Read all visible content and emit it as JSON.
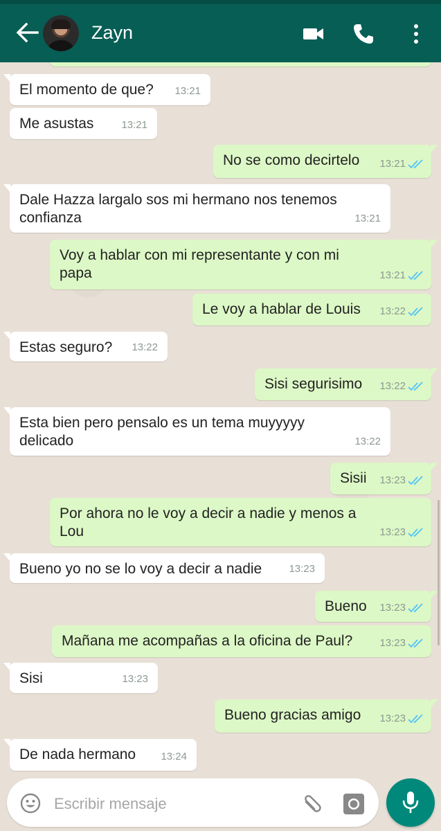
{
  "header": {
    "contact_name": "Zayn",
    "icons": [
      "back-arrow-icon",
      "video-call-icon",
      "phone-icon",
      "more-vertical-icon"
    ]
  },
  "messages": [
    {
      "dir": "in",
      "text": [
        "El momento de que?"
      ],
      "time": "13:21"
    },
    {
      "dir": "in",
      "text": [
        "Me asustas"
      ],
      "time": "13:21"
    },
    {
      "dir": "out",
      "text": [
        "No se como decirtelo"
      ],
      "time": "13:21"
    },
    {
      "dir": "in",
      "text": [
        "Dale Hazza largalo sos mi hermano nos tenemos",
        "confianza"
      ],
      "time": "13:21"
    },
    {
      "dir": "out",
      "text": [
        "Voy a hablar con mi representante y con mi",
        "papa"
      ],
      "time": "13:21"
    },
    {
      "dir": "out",
      "text": [
        "Le voy a hablar de Louis"
      ],
      "time": "13:22"
    },
    {
      "dir": "in",
      "text": [
        "Estas seguro?"
      ],
      "time": "13:22"
    },
    {
      "dir": "out",
      "text": [
        "Sisi segurisimo"
      ],
      "time": "13:22"
    },
    {
      "dir": "in",
      "text": [
        "Esta bien pero pensalo es un tema muyyyyy",
        "delicado"
      ],
      "time": "13:22"
    },
    {
      "dir": "out",
      "text": [
        "Sisii"
      ],
      "time": "13:23"
    },
    {
      "dir": "out",
      "text": [
        "Por ahora no le voy a decir a nadie y menos a",
        "Lou"
      ],
      "time": "13:23"
    },
    {
      "dir": "in",
      "text": [
        "Bueno yo no se lo voy a decir a nadie"
      ],
      "time": "13:23"
    },
    {
      "dir": "out",
      "text": [
        "Bueno"
      ],
      "time": "13:23"
    },
    {
      "dir": "out",
      "text": [
        "Mañana me acompañas a la oficina de Paul?"
      ],
      "time": "13:23"
    },
    {
      "dir": "in",
      "text": [
        "Sisi"
      ],
      "time": "13:23"
    },
    {
      "dir": "out",
      "text": [
        "Bueno gracias amigo"
      ],
      "time": "13:23"
    },
    {
      "dir": "in",
      "text": [
        "De nada hermano"
      ],
      "time": "13:24"
    }
  ],
  "input": {
    "placeholder": "Escribir mensaje"
  },
  "colors": {
    "header": "#075e54",
    "outgoing_bubble": "#dcf8c6",
    "incoming_bubble": "#ffffff",
    "read_ticks": "#4fc3f7",
    "mic_button": "#00897b"
  }
}
